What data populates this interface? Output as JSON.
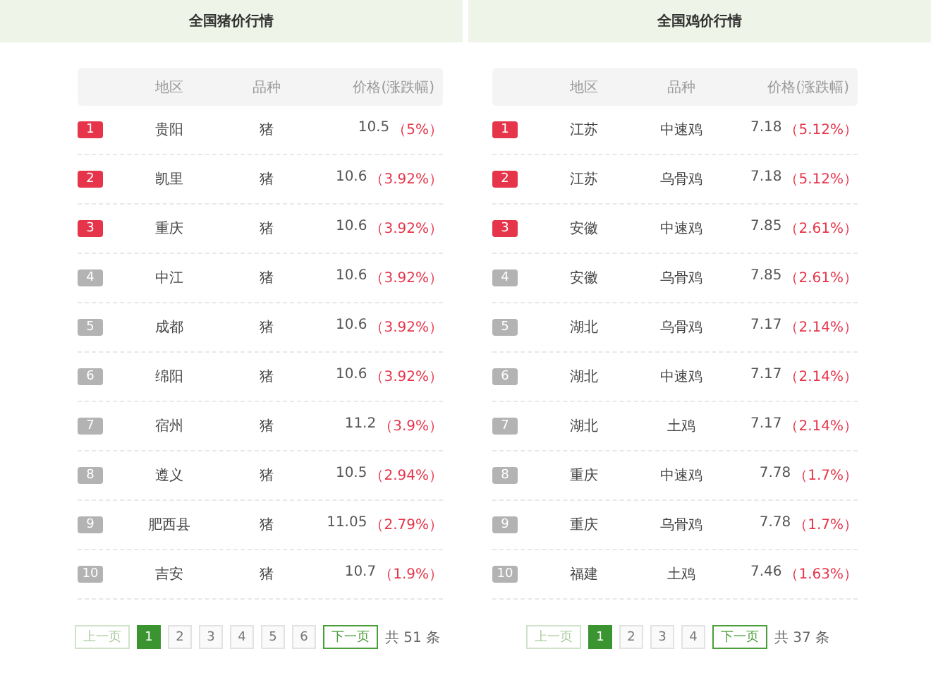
{
  "panels": [
    {
      "title": "全国猪价行情",
      "columns": [
        "地区",
        "品种",
        "价格(涨跌幅)"
      ],
      "rows": [
        {
          "rank": "1",
          "top": true,
          "area": "贵阳",
          "variety": "猪",
          "price": "10.5",
          "change": "（5%）"
        },
        {
          "rank": "2",
          "top": true,
          "area": "凯里",
          "variety": "猪",
          "price": "10.6",
          "change": "（3.92%）"
        },
        {
          "rank": "3",
          "top": true,
          "area": "重庆",
          "variety": "猪",
          "price": "10.6",
          "change": "（3.92%）"
        },
        {
          "rank": "4",
          "top": false,
          "area": "中江",
          "variety": "猪",
          "price": "10.6",
          "change": "（3.92%）"
        },
        {
          "rank": "5",
          "top": false,
          "area": "成都",
          "variety": "猪",
          "price": "10.6",
          "change": "（3.92%）"
        },
        {
          "rank": "6",
          "top": false,
          "area": "绵阳",
          "variety": "猪",
          "price": "10.6",
          "change": "（3.92%）"
        },
        {
          "rank": "7",
          "top": false,
          "area": "宿州",
          "variety": "猪",
          "price": "11.2",
          "change": "（3.9%）"
        },
        {
          "rank": "8",
          "top": false,
          "area": "遵义",
          "variety": "猪",
          "price": "10.5",
          "change": "（2.94%）"
        },
        {
          "rank": "9",
          "top": false,
          "area": "肥西县",
          "variety": "猪",
          "price": "11.05",
          "change": "（2.79%）"
        },
        {
          "rank": "10",
          "top": false,
          "area": "吉安",
          "variety": "猪",
          "price": "10.7",
          "change": "（1.9%）"
        }
      ],
      "pagination": {
        "prev": {
          "label": "上一页",
          "disabled": true
        },
        "pages": [
          {
            "label": "1",
            "selected": true
          },
          {
            "label": "2",
            "selected": false
          },
          {
            "label": "3",
            "selected": false
          },
          {
            "label": "4",
            "selected": false
          },
          {
            "label": "5",
            "selected": false
          },
          {
            "label": "6",
            "selected": false
          }
        ],
        "next": {
          "label": "下一页",
          "disabled": false
        },
        "total": "共 51 条"
      }
    },
    {
      "title": "全国鸡价行情",
      "columns": [
        "地区",
        "品种",
        "价格(涨跌幅)"
      ],
      "rows": [
        {
          "rank": "1",
          "top": true,
          "area": "江苏",
          "variety": "中速鸡",
          "price": "7.18",
          "change": "（5.12%）"
        },
        {
          "rank": "2",
          "top": true,
          "area": "江苏",
          "variety": "乌骨鸡",
          "price": "7.18",
          "change": "（5.12%）"
        },
        {
          "rank": "3",
          "top": true,
          "area": "安徽",
          "variety": "中速鸡",
          "price": "7.85",
          "change": "（2.61%）"
        },
        {
          "rank": "4",
          "top": false,
          "area": "安徽",
          "variety": "乌骨鸡",
          "price": "7.85",
          "change": "（2.61%）"
        },
        {
          "rank": "5",
          "top": false,
          "area": "湖北",
          "variety": "乌骨鸡",
          "price": "7.17",
          "change": "（2.14%）"
        },
        {
          "rank": "6",
          "top": false,
          "area": "湖北",
          "variety": "中速鸡",
          "price": "7.17",
          "change": "（2.14%）"
        },
        {
          "rank": "7",
          "top": false,
          "area": "湖北",
          "variety": "土鸡",
          "price": "7.17",
          "change": "（2.14%）"
        },
        {
          "rank": "8",
          "top": false,
          "area": "重庆",
          "variety": "中速鸡",
          "price": "7.78",
          "change": "（1.7%）"
        },
        {
          "rank": "9",
          "top": false,
          "area": "重庆",
          "variety": "乌骨鸡",
          "price": "7.78",
          "change": "（1.7%）"
        },
        {
          "rank": "10",
          "top": false,
          "area": "福建",
          "variety": "土鸡",
          "price": "7.46",
          "change": "（1.63%）"
        }
      ],
      "pagination": {
        "prev": {
          "label": "上一页",
          "disabled": true
        },
        "pages": [
          {
            "label": "1",
            "selected": true
          },
          {
            "label": "2",
            "selected": false
          },
          {
            "label": "3",
            "selected": false
          },
          {
            "label": "4",
            "selected": false
          }
        ],
        "next": {
          "label": "下一页",
          "disabled": false
        },
        "total": "共 37 条"
      }
    }
  ]
}
